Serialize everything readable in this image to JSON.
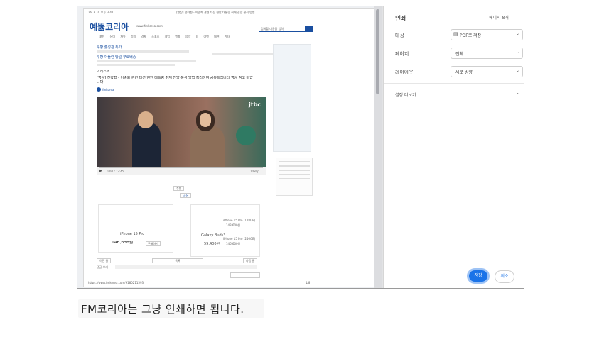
{
  "print_panel": {
    "title": "인쇄",
    "page_count": "페이지 8개",
    "destination_label": "대상",
    "destination_value": "PDF로 저장",
    "pages_label": "페이지",
    "pages_value": "전체",
    "layout_label": "레이아웃",
    "layout_value": "세로 방향",
    "more_settings": "설정 더보기",
    "save_button": "저장",
    "cancel_button": "취소"
  },
  "preview": {
    "top_left_text": "26. 8. 2. 오후 3:47",
    "top_title": "[영상] 전략형 - 이준화 관련 대선 현안 대통령 취재 전망 분석 방법",
    "site_logo": "예뚫코리아",
    "site_url": "www.fmkorea.com",
    "search_placeholder": "검색할 내용을 입력",
    "nav_items": [
      "포텐",
      "유머",
      "자유",
      "정치",
      "경제",
      "스포츠",
      "게임",
      "영화",
      "음악",
      "IT",
      "여행",
      "패션",
      "기타"
    ],
    "ad_title_1": "쿠팡 출성관 특가",
    "ad_title_2": "쿠팡 아뜰란 당일 무료배송",
    "sub_label": "빅리스텍",
    "article_title": "[영상] 전략형 - 이준화 관련 대선 현안 대통령 취재 전망 분석 방법 정리하여 공유드립니다 영상 참고 바랍니다",
    "author": "fmkorea",
    "video_logo": "jtbc",
    "video_time": "0:00 / 12:45",
    "video_hd": "1080p",
    "btn_recommend": "추천",
    "btn_share": "공유",
    "ad_left_title": "iPhone 15 Pro",
    "ad_left_price": "146,656원",
    "ad_left_btn": "구매하기",
    "ad_mid_title": "Galaxy Buds3",
    "ad_mid_price": "59,400원",
    "ad_right_title": "iPhone 15 Pro (128GB)",
    "ad_right_price": "143,600원",
    "ad_right_title2": "iPhone 15 Pro (256GB)",
    "ad_right_price2": "146,600원",
    "bottom_btn_prev": "이전 글",
    "bottom_btn_list": "목록",
    "bottom_btn_next": "다음 글",
    "comment_label": "댓글 쓰기",
    "footer_url": "https://www.fmkorea.com/9180211593",
    "footer_page": "1/8"
  },
  "caption": {
    "text": "FM코리아는 그냥 인쇄하면 됩니다."
  },
  "colors": {
    "accent_blue": "#1a73e8",
    "logo_blue": "#1a4fa0"
  }
}
